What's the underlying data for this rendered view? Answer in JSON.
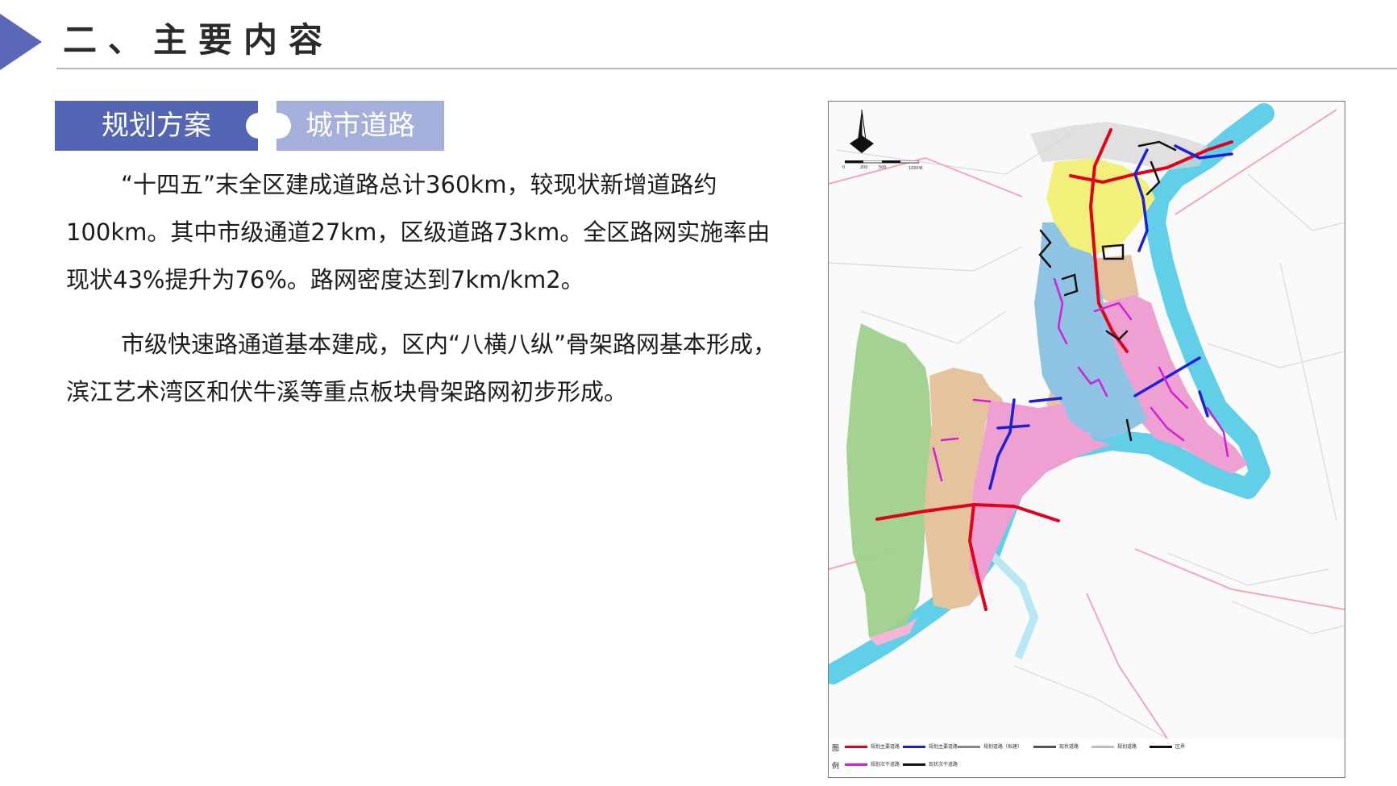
{
  "header": {
    "title": "二、主要内容"
  },
  "tabs": {
    "plan": "规划方案",
    "road": "城市道路"
  },
  "content": {
    "paragraph1": "“十四五”末全区建成道路总计360km，较现状新增道路约100km。其中市级通道27km，区级道路73km。全区路网实施率由现状43%提升为76%。路网密度达到7km/km2。",
    "paragraph2": "市级快速路通道基本建成，区内“八横八纵”骨架路网基本形成，滨江艺术湾区和伏牛溪等重点板块骨架路网初步形成。"
  },
  "colors": {
    "accent": "#5466b3",
    "accent_light": "#a4afdb",
    "arrow": "#5a67b6",
    "road_red": "#e3001b",
    "road_blue": "#1f1fd6",
    "road_magenta": "#d21fd8",
    "road_black": "#111111",
    "river": "#62cfe8",
    "zone_yellow": "#f2ef7a",
    "zone_blue": "#8fc3e3",
    "zone_pink": "#efa0d2",
    "zone_tan": "#e6c39f",
    "zone_green": "#9fd08d"
  },
  "map": {
    "north_icon": "north-arrow-icon",
    "scale_labels": [
      "0",
      "200",
      "500",
      "1000米"
    ],
    "legend": {
      "head_top": "图",
      "head_bottom": "例",
      "items": [
        {
          "label": "规划主要道路",
          "color": "#e3001b"
        },
        {
          "label": "规划主要道路",
          "color": "#1f1fd6"
        },
        {
          "label": "规划道路（拟建）",
          "color": "#888888"
        },
        {
          "label": "现状道路",
          "color": "#555555"
        },
        {
          "label": "规划道路",
          "color": "#bbbbbb"
        },
        {
          "label": "区界",
          "color": "#111111"
        },
        {
          "label": "规划次干道路",
          "color": "#d21fd8"
        },
        {
          "label": "现状次干道路",
          "color": "#111111"
        }
      ]
    }
  }
}
